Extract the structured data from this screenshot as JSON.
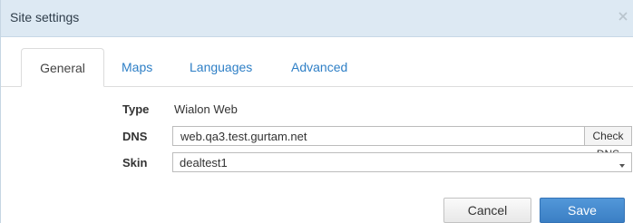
{
  "dialog": {
    "title": "Site settings",
    "close_icon": "close-icon"
  },
  "tabs": [
    {
      "label": "General",
      "active": true
    },
    {
      "label": "Maps",
      "active": false
    },
    {
      "label": "Languages",
      "active": false
    },
    {
      "label": "Advanced",
      "active": false
    }
  ],
  "form": {
    "type_label": "Type",
    "type_value": "Wialon Web",
    "dns_label": "DNS",
    "dns_value": "web.qa3.test.gurtam.net",
    "check_dns_label": "Check DNS",
    "skin_label": "Skin",
    "skin_value": "dealtest1",
    "skin_icon": "chevron-down-icon"
  },
  "footer": {
    "cancel_label": "Cancel",
    "save_label": "Save"
  },
  "colors": {
    "titlebar": "#dde9f3",
    "link_tab": "#2e7fc6",
    "save_button": "#3b7fc4"
  }
}
